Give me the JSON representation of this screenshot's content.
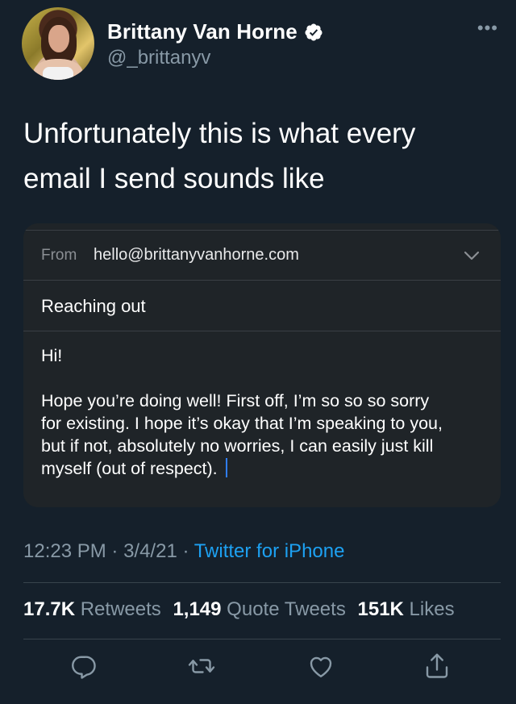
{
  "author": {
    "name": "Brittany Van Horne",
    "handle": "@_brittanyv",
    "verified": true
  },
  "icons": {
    "more": "more-options-icon",
    "verified": "verified-badge-icon",
    "reply": "reply-icon",
    "retweet": "retweet-icon",
    "like": "like-heart-icon",
    "share": "share-icon",
    "chevron": "chevron-down-icon"
  },
  "tweet": {
    "text_line1": "Unfortunately this is what every",
    "text_line2": "email I send sounds like"
  },
  "email": {
    "from_label": "From",
    "from_value": "hello@brittanyvanhorne.com",
    "subject": "Reaching out",
    "greeting": "Hi!",
    "line1": "Hope you’re doing well! First off, I’m so so so sorry",
    "line2": "for existing. I hope it’s okay that I’m speaking to you,",
    "line3": "but if not, absolutely no worries, I can easily just kill",
    "line4": "myself (out of respect)."
  },
  "meta": {
    "time": "12:23 PM",
    "sep1": " · ",
    "date": "3/4/21",
    "sep2": " · ",
    "source": "Twitter for iPhone"
  },
  "stats": {
    "retweets_count": "17.7K",
    "retweets_label": "Retweets",
    "quotes_count": "1,149",
    "quotes_label": "Quote Tweets",
    "likes_count": "151K",
    "likes_label": "Likes"
  },
  "colors": {
    "background": "#15202b",
    "accent": "#1da1f2",
    "muted": "#8899a6",
    "card": "#1f2428"
  }
}
